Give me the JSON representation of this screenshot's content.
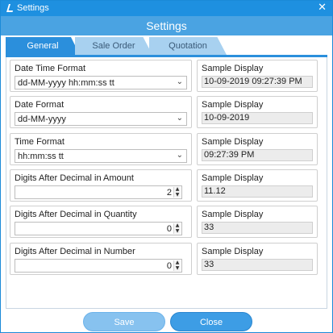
{
  "window": {
    "title": "Settings",
    "close_glyph": "✕"
  },
  "header": {
    "title": "Settings"
  },
  "tabs": [
    {
      "label": "General",
      "active": true
    },
    {
      "label": "Sale Order",
      "active": false
    },
    {
      "label": "Quotation",
      "active": false
    }
  ],
  "fields": {
    "datetime": {
      "label": "Date Time Format",
      "value": "dd-MM-yyyy hh:mm:ss tt",
      "sample_label": "Sample Display",
      "sample": "10-09-2019 09:27:39 PM"
    },
    "date": {
      "label": "Date Format",
      "value": "dd-MM-yyyy",
      "sample_label": "Sample Display",
      "sample": "10-09-2019"
    },
    "time": {
      "label": "Time Format",
      "value": "hh:mm:ss tt",
      "sample_label": "Sample Display",
      "sample": "09:27:39 PM"
    },
    "amount": {
      "label": "Digits After Decimal in Amount",
      "value": "2",
      "sample_label": "Sample Display",
      "sample": "11.12"
    },
    "quantity": {
      "label": "Digits After Decimal in Quantity",
      "value": "0",
      "sample_label": "Sample Display",
      "sample": "33"
    },
    "number": {
      "label": "Digits After Decimal in Number",
      "value": "0",
      "sample_label": "Sample Display",
      "sample": "33"
    }
  },
  "buttons": {
    "save": "Save",
    "close": "Close"
  },
  "colors": {
    "titlebar": "#1e90e0",
    "header": "#4aa3e2",
    "active_tab": "#2b8fdc",
    "inactive_tab": "#a8d1f0"
  },
  "icons": {
    "app": "app-logo-icon",
    "chevron": "chevron-down-icon",
    "spin_up": "spin-up-icon",
    "spin_down": "spin-down-icon"
  }
}
